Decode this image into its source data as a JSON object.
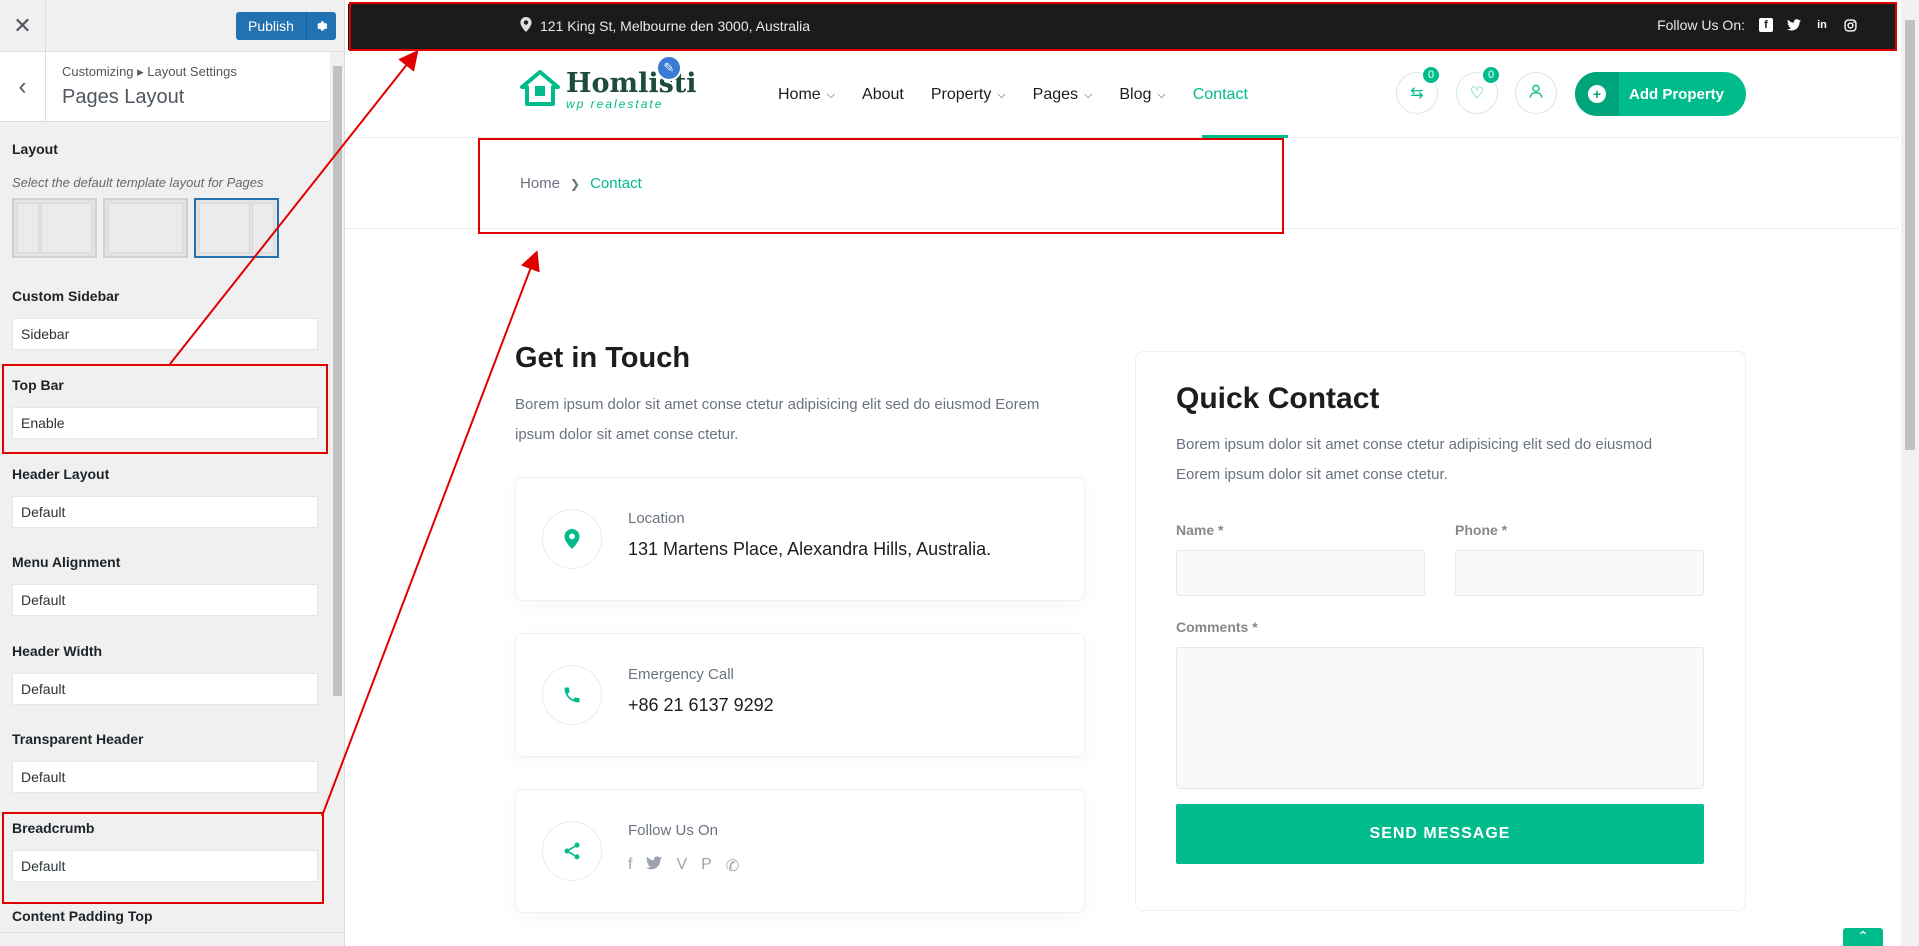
{
  "customizer": {
    "close_icon": "✕",
    "publish_label": "Publish",
    "breadcrumb": "Customizing ▸ Layout Settings",
    "title": "Pages Layout",
    "layout": {
      "label": "Layout",
      "description": "Select the default template layout for Pages",
      "selected_index": 2
    },
    "fields": [
      {
        "label": "Custom Sidebar",
        "value": "Sidebar"
      },
      {
        "label": "Top Bar",
        "value": "Enable"
      },
      {
        "label": "Header Layout",
        "value": "Default"
      },
      {
        "label": "Menu Alignment",
        "value": "Default"
      },
      {
        "label": "Header Width",
        "value": "Default"
      },
      {
        "label": "Transparent Header",
        "value": "Default"
      },
      {
        "label": "Breadcrumb",
        "value": "Default"
      },
      {
        "label": "Content Padding Top",
        "value": ""
      }
    ]
  },
  "site": {
    "topbar": {
      "address": "121 King St, Melbourne den 3000, Australia",
      "follow_label": "Follow Us On:"
    },
    "logo": {
      "name": "Homlisti",
      "tagline": "wp realestate"
    },
    "nav": [
      {
        "label": "Home",
        "dropdown": true
      },
      {
        "label": "About",
        "dropdown": false
      },
      {
        "label": "Property",
        "dropdown": true
      },
      {
        "label": "Pages",
        "dropdown": true
      },
      {
        "label": "Blog",
        "dropdown": true
      },
      {
        "label": "Contact",
        "dropdown": false,
        "active": true
      }
    ],
    "compare_count": "0",
    "favorites_count": "0",
    "add_property_label": "Add Property",
    "breadcrumb": {
      "home": "Home",
      "current": "Contact"
    },
    "get_in_touch": {
      "title": "Get in Touch",
      "description": "Borem ipsum dolor sit amet conse ctetur adipisicing elit sed do eiusmod Eorem ipsum dolor sit amet conse ctetur."
    },
    "cards": {
      "location": {
        "label": "Location",
        "value": "131 Martens Place, Alexandra Hills, Australia."
      },
      "emergency": {
        "label": "Emergency Call",
        "value": "+86 21 6137 9292"
      },
      "follow": {
        "label": "Follow Us On"
      }
    },
    "quick_contact": {
      "title": "Quick Contact",
      "description": "Borem ipsum dolor sit amet conse ctetur adipisicing elit sed do eiusmod Eorem ipsum dolor sit amet conse ctetur.",
      "name_label": "Name *",
      "phone_label": "Phone *",
      "comments_label": "Comments *",
      "submit_label": "SEND MESSAGE"
    }
  },
  "colors": {
    "accent": "#00bb8c",
    "topbar_bg": "#1b1b1b",
    "publish_bg": "#2271b1",
    "annotation": "#e00000"
  }
}
